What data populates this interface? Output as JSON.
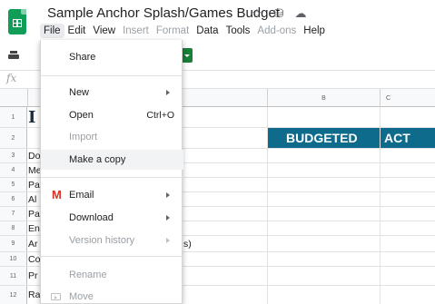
{
  "header": {
    "title": "Sample Anchor Splash/Games Budget",
    "icons": [
      "star-icon",
      "move-to-drive-icon",
      "cloud-status-icon"
    ],
    "star_glyph": "☆",
    "drive_glyph": "⛁",
    "cloud_glyph": "☁"
  },
  "menubar": {
    "items": [
      {
        "label": "File",
        "state": "active"
      },
      {
        "label": "Edit",
        "state": "normal"
      },
      {
        "label": "View",
        "state": "normal"
      },
      {
        "label": "Insert",
        "state": "dim"
      },
      {
        "label": "Format",
        "state": "dim"
      },
      {
        "label": "Data",
        "state": "normal"
      },
      {
        "label": "Tools",
        "state": "normal"
      },
      {
        "label": "Add-ons",
        "state": "dim"
      },
      {
        "label": "Help",
        "state": "normal"
      }
    ]
  },
  "formula_bar": {
    "fx": "fx"
  },
  "sheet": {
    "columns": [
      {
        "label": ""
      },
      {
        "label": "B"
      },
      {
        "label": "C"
      }
    ],
    "rows": [
      {
        "num": "1",
        "a": "I",
        "b": "",
        "c": ""
      },
      {
        "num": "2",
        "a": "",
        "b": "BUDGETED",
        "c": "ACT"
      },
      {
        "num": "3",
        "a": "Do",
        "b": "",
        "c": ""
      },
      {
        "num": "4",
        "a": "Me",
        "b": "",
        "c": ""
      },
      {
        "num": "5",
        "a": "Pa",
        "b": "",
        "c": ""
      },
      {
        "num": "6",
        "a": "Al",
        "b": "",
        "c": ""
      },
      {
        "num": "7",
        "a": "Pa",
        "b": "",
        "c": ""
      },
      {
        "num": "8",
        "a": "En",
        "b": "",
        "c": ""
      },
      {
        "num": "9",
        "a": "Ar",
        "b": "",
        "c": ""
      },
      {
        "num": "10",
        "a": "Co",
        "b": "",
        "c": ""
      },
      {
        "num": "11",
        "a": "Pr",
        "b": "",
        "c": ""
      },
      {
        "num": "12",
        "a": "Ra",
        "b": "",
        "c": ""
      }
    ],
    "overflow_text": "s)",
    "header_fill": "#0e6b8c"
  },
  "file_menu": {
    "items": [
      {
        "label": "Share",
        "shortcut": "",
        "submenu": false,
        "disabled": false
      },
      {
        "label": "New",
        "shortcut": "",
        "submenu": true,
        "disabled": false
      },
      {
        "label": "Open",
        "shortcut": "Ctrl+O",
        "submenu": false,
        "disabled": false
      },
      {
        "label": "Import",
        "shortcut": "",
        "submenu": false,
        "disabled": true
      },
      {
        "label": "Make a copy",
        "shortcut": "",
        "submenu": false,
        "disabled": false,
        "hover": true
      },
      {
        "label": "Email",
        "shortcut": "",
        "submenu": true,
        "disabled": false,
        "icon": "gmail-icon"
      },
      {
        "label": "Download",
        "shortcut": "",
        "submenu": true,
        "disabled": false
      },
      {
        "label": "Version history",
        "shortcut": "",
        "submenu": true,
        "disabled": true
      },
      {
        "label": "Rename",
        "shortcut": "",
        "submenu": false,
        "disabled": true
      },
      {
        "label": "Move",
        "shortcut": "",
        "submenu": false,
        "disabled": true,
        "icon": "move-icon"
      }
    ]
  },
  "colors": {
    "brand_green": "#0f9d58",
    "header_teal": "#0e6b8c",
    "gmail_red": "#d93025"
  }
}
